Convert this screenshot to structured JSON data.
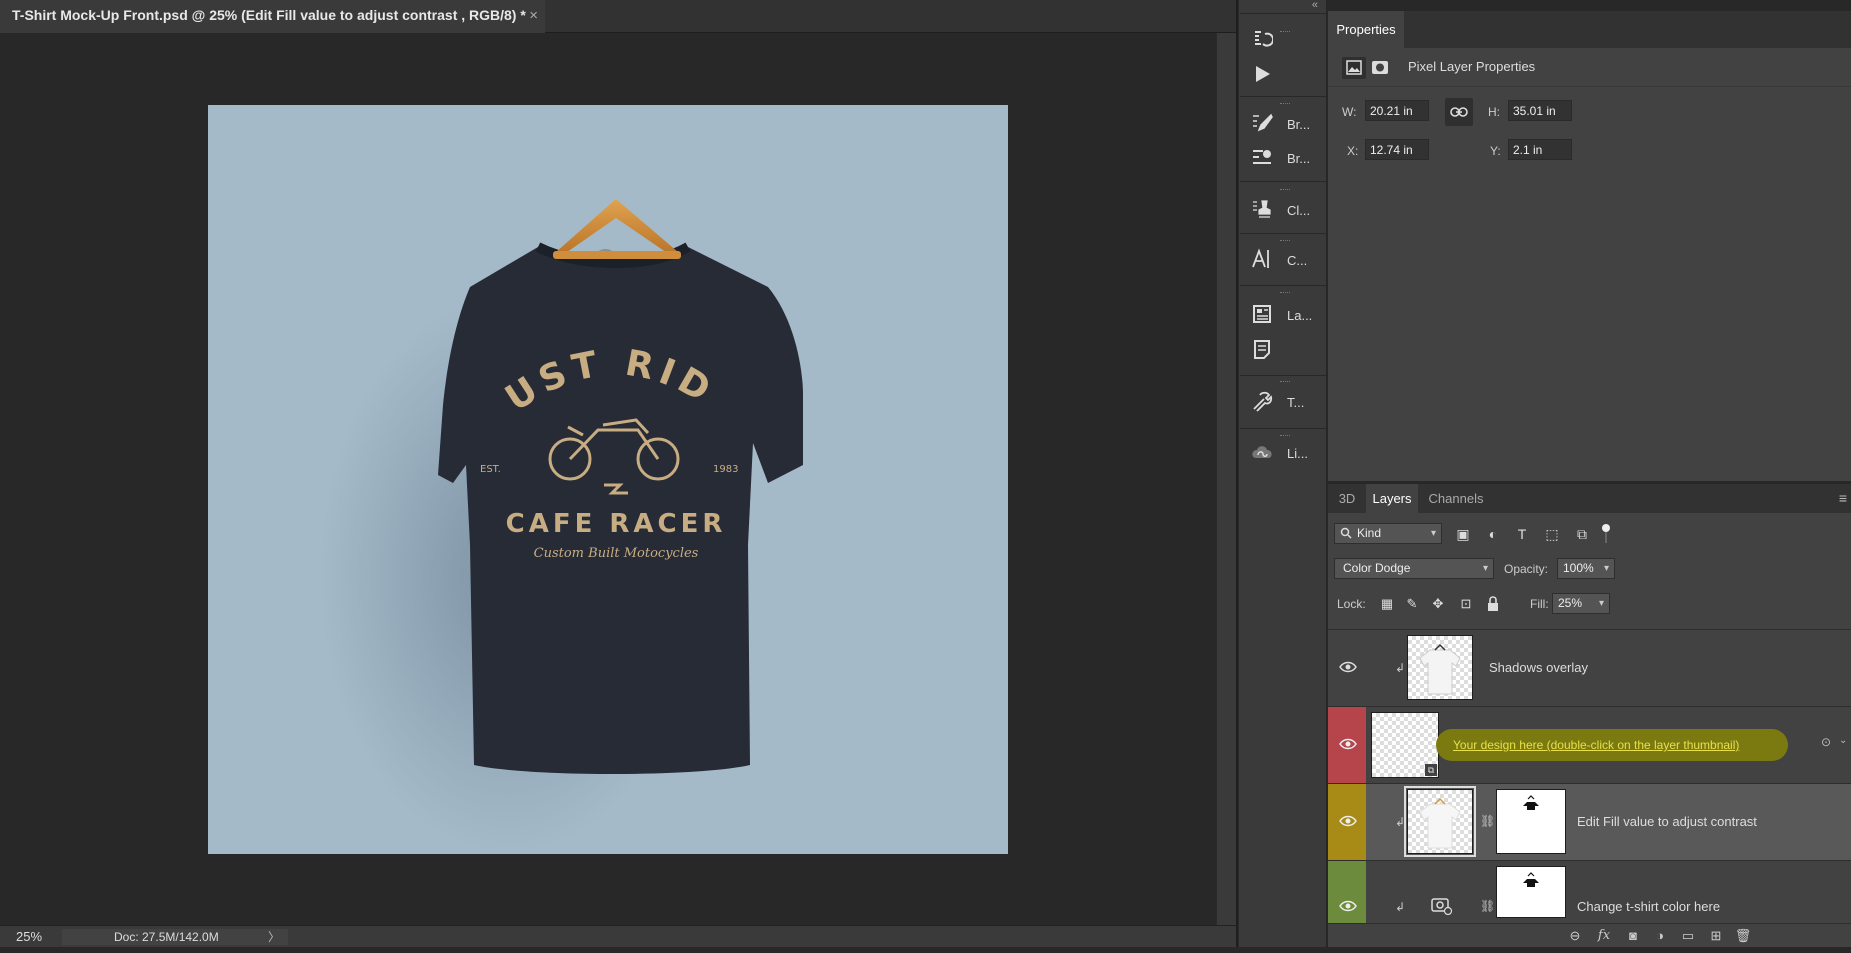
{
  "document": {
    "tab_title": "T-Shirt Mock-Up Front.psd @ 25% (Edit Fill value to adjust contrast , RGB/8) *",
    "tab_close": "×",
    "canvas": {
      "background_color": "#a5bac9",
      "shirt_color": "#262b36",
      "print_color": "#c8ad82",
      "artwork": {
        "line1": "JUST RIDE",
        "est": "EST.",
        "year": "1983",
        "line2": "CAFE RACER",
        "line3": "Custom Built Motocycles"
      }
    }
  },
  "status_bar": {
    "zoom": "25%",
    "doc_info": "Doc: 27.5M/142.0M",
    "arrow": "〉"
  },
  "tools": {
    "collapse": "«",
    "items": [
      {
        "name": "history-icon",
        "label": ""
      },
      {
        "name": "actions-play-icon",
        "label": ""
      },
      {
        "name": "brush-icon",
        "label": "Br..."
      },
      {
        "name": "brush-settings-icon",
        "label": "Br..."
      },
      {
        "name": "clone-source-icon",
        "label": "Cl..."
      },
      {
        "name": "character-icon",
        "label": "C..."
      },
      {
        "name": "layer-comps-icon",
        "label": "La..."
      },
      {
        "name": "notes-icon",
        "label": ""
      },
      {
        "name": "tool-presets-icon",
        "label": "T..."
      },
      {
        "name": "libraries-icon",
        "label": "Li..."
      }
    ]
  },
  "properties": {
    "tab_label": "Properties",
    "header_label": "Pixel Layer Properties",
    "w_label": "W:",
    "w_value": "20.21 in",
    "h_label": "H:",
    "h_value": "35.01 in",
    "x_label": "X:",
    "x_value": "12.74 in",
    "y_label": "Y:",
    "y_value": "2.1 in"
  },
  "layers_panel": {
    "tabs": [
      "3D",
      "Layers",
      "Channels"
    ],
    "menu": "≡",
    "filter_kind": "Kind",
    "blend_mode": "Color Dodge",
    "opacity_label": "Opacity:",
    "opacity_value": "100%",
    "lock_label": "Lock:",
    "fill_label": "Fill:",
    "fill_value": "25%",
    "layers": [
      {
        "name": "Shadows overlay",
        "color": "",
        "visible": true
      },
      {
        "name": "Your design here (double-click on the layer thumbnail)",
        "color": "#b5454a",
        "visible": true
      },
      {
        "name": "Edit Fill value to adjust contrast",
        "color": "#a88b17",
        "visible": true,
        "selected": true
      },
      {
        "name": "Change t-shirt color here",
        "color": "#6d8b3d",
        "visible": true
      }
    ]
  },
  "colors": {
    "highlight_yellow": "#7a7a10",
    "link_text": "#e7e04a"
  }
}
